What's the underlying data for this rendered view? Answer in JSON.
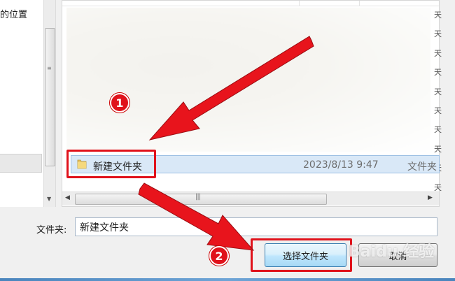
{
  "nav": {
    "location_text": "的位置"
  },
  "file_list": {
    "row": {
      "name": "新建文件夹",
      "date": "2023/8/13 9:47",
      "type": "文件夹"
    },
    "right_edge_glyphs": "天\n天\n天\n天\n天\n天\n天\n天\n天\n天"
  },
  "bottom": {
    "folder_label": "文件夹:",
    "folder_value": "新建文件夹",
    "select_button": "选择文件夹",
    "cancel_button": "取消"
  },
  "annotations": {
    "step_1": "1",
    "step_2": "2",
    "highlight_color": "#e0121b"
  },
  "watermark": "Baidu 经验",
  "colors": {
    "selection_bg": "#d9e8f7",
    "primary_button_border": "#3c7fb1"
  }
}
